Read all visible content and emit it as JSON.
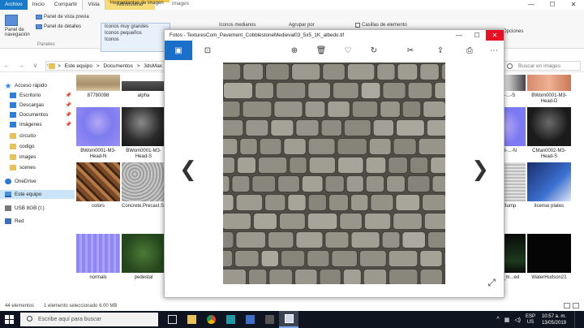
{
  "explorer": {
    "tabs": {
      "file": "Archivo",
      "home": "Inicio",
      "share": "Compartir",
      "view": "Vista",
      "manage": "Administrar"
    },
    "tools_header": "Herramientas de imagen",
    "title_hint": "images",
    "ribbon": {
      "nav_pane": "Panel de navegación",
      "preview_pane": "Panel de vista previa",
      "details_pane": "Panel de detalles",
      "panes_group": "Paneles",
      "layout": [
        "Iconos muy grandes",
        "Iconos pequeños",
        "Iconos",
        "Iconos medianos"
      ],
      "group_by": "Agrupar por",
      "checkboxes": "Casillas de elemento",
      "options": "Opciones"
    },
    "address": {
      "nav_arrows": "← → ∨ ↑",
      "crumbs": [
        ">",
        "Este equipo",
        ">",
        "Documentos",
        ">",
        "3dsMax",
        ">"
      ],
      "search_placeholder": "Buscar en images"
    },
    "nav": {
      "quick_access": "Acceso rápido",
      "desktop": "Escritorio",
      "downloads": "Descargas",
      "documents": "Documentos",
      "images": "Imágenes",
      "folders": [
        "circuito",
        "codigo",
        "images",
        "scenes"
      ],
      "onedrive": "OneDrive",
      "this_pc": "Este equipo",
      "usb": "USB 8GB (I:)",
      "network": "Red",
      "pin": "📌"
    },
    "files_left": [
      {
        "name": "87780098"
      },
      {
        "name": "alpha"
      },
      {
        "name": "BWom0001-M3-Head-N"
      },
      {
        "name": "BWom0001-M3-Head-S"
      },
      {
        "name": "colors"
      },
      {
        "name": "Concrete.Precast.Structural.Concrete.Smooth.bump"
      },
      {
        "name": "normals"
      },
      {
        "name": "pedestal"
      }
    ],
    "files_right": [
      {
        "name": "BWom0001-M3-Head-D"
      },
      {
        "name": "...-M3-...-S"
      },
      {
        "name": "CMan0002-M3-Head-S"
      },
      {
        "name": "...2-M3-...-N"
      },
      {
        "name": "...01_Bump"
      },
      {
        "name": "license plates"
      },
      {
        "name": "...ne29_m...ed"
      },
      {
        "name": "WaterHudson21"
      }
    ],
    "status": {
      "count": "44 elementos",
      "selected": "1 elemento seleccionado  6.00 MB"
    }
  },
  "photos": {
    "title": "Fotos - TexturesCom_Pavement_CobblestoneMedieval03_5x5_1K_albedo.tif",
    "controls": {
      "minimize": "—",
      "maximize": "☐",
      "close": "✕"
    },
    "toolbar_icons": [
      "image-icon",
      "slideshow-icon",
      "zoom-icon",
      "delete-icon",
      "favorite-icon",
      "rotate-icon",
      "edit-icon",
      "share-icon",
      "print-icon",
      "more-icon"
    ],
    "toolbar_glyphs": [
      "▣",
      "⊡",
      "⊕",
      "🗑",
      "♡",
      "↻",
      "✂",
      "⇪",
      "⎙",
      "⋯"
    ],
    "prev": "❮",
    "next": "❯",
    "expand": "⤢"
  },
  "taskbar": {
    "search_placeholder": "Escribe aquí para buscar",
    "lang": "ESP",
    "lang_sub": "US",
    "time": "10:57 a. m.",
    "date": "13/05/2019",
    "apps": [
      "task-view",
      "file-explorer",
      "chrome",
      "3dsmax",
      "app5",
      "app6",
      "photos"
    ]
  },
  "colors": {
    "accent": "#1a6fc9",
    "close": "#e81123",
    "taskbar": "#0f1520"
  }
}
